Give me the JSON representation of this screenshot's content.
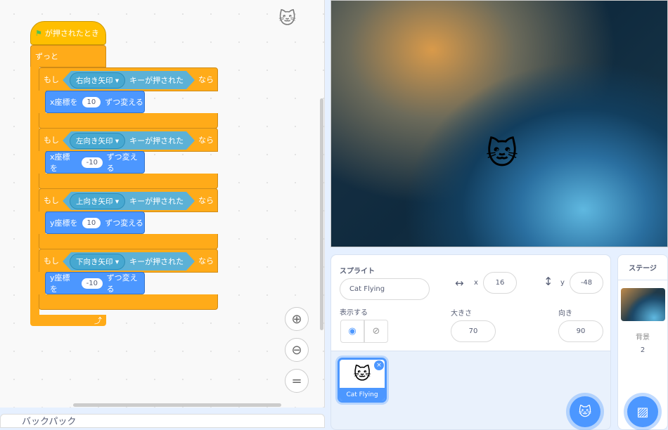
{
  "code": {
    "hat": "が押されたとき",
    "forever": "ずっと",
    "if_blocks": [
      {
        "if": "もし",
        "key": "右向き矢印",
        "pressed": "キーが押された",
        "then": "なら",
        "cmd": "x座標を",
        "value": "10",
        "cmd_end": "ずつ変える"
      },
      {
        "if": "もし",
        "key": "左向き矢印",
        "pressed": "キーが押された",
        "then": "なら",
        "cmd": "x座標を",
        "value": "-10",
        "cmd_end": "ずつ変える"
      },
      {
        "if": "もし",
        "key": "上向き矢印",
        "pressed": "キーが押された",
        "then": "なら",
        "cmd": "y座標を",
        "value": "10",
        "cmd_end": "ずつ変える"
      },
      {
        "if": "もし",
        "key": "下向き矢印",
        "pressed": "キーが押された",
        "then": "なら",
        "cmd": "y座標を",
        "value": "-10",
        "cmd_end": "ずつ変える"
      }
    ],
    "zoom_in": "+",
    "zoom_out": "−",
    "zoom_reset": "="
  },
  "backpack": "バックパック",
  "sprite_info": {
    "sprite_label": "スプライト",
    "sprite_name": "Cat Flying",
    "x_label": "x",
    "x": "16",
    "y_label": "y",
    "y": "-48",
    "show_label": "表示する",
    "size_label": "大きさ",
    "size": "70",
    "direction_label": "向き",
    "direction": "90"
  },
  "sprites": [
    {
      "name": "Cat Flying"
    }
  ],
  "stage_panel": {
    "title": "ステージ",
    "backdrop_label": "背景",
    "backdrop_count": "2"
  },
  "colors": {
    "events": "#ffbf00",
    "control": "#ffab19",
    "motion": "#4c97ff",
    "sensing": "#5cb1d6"
  }
}
